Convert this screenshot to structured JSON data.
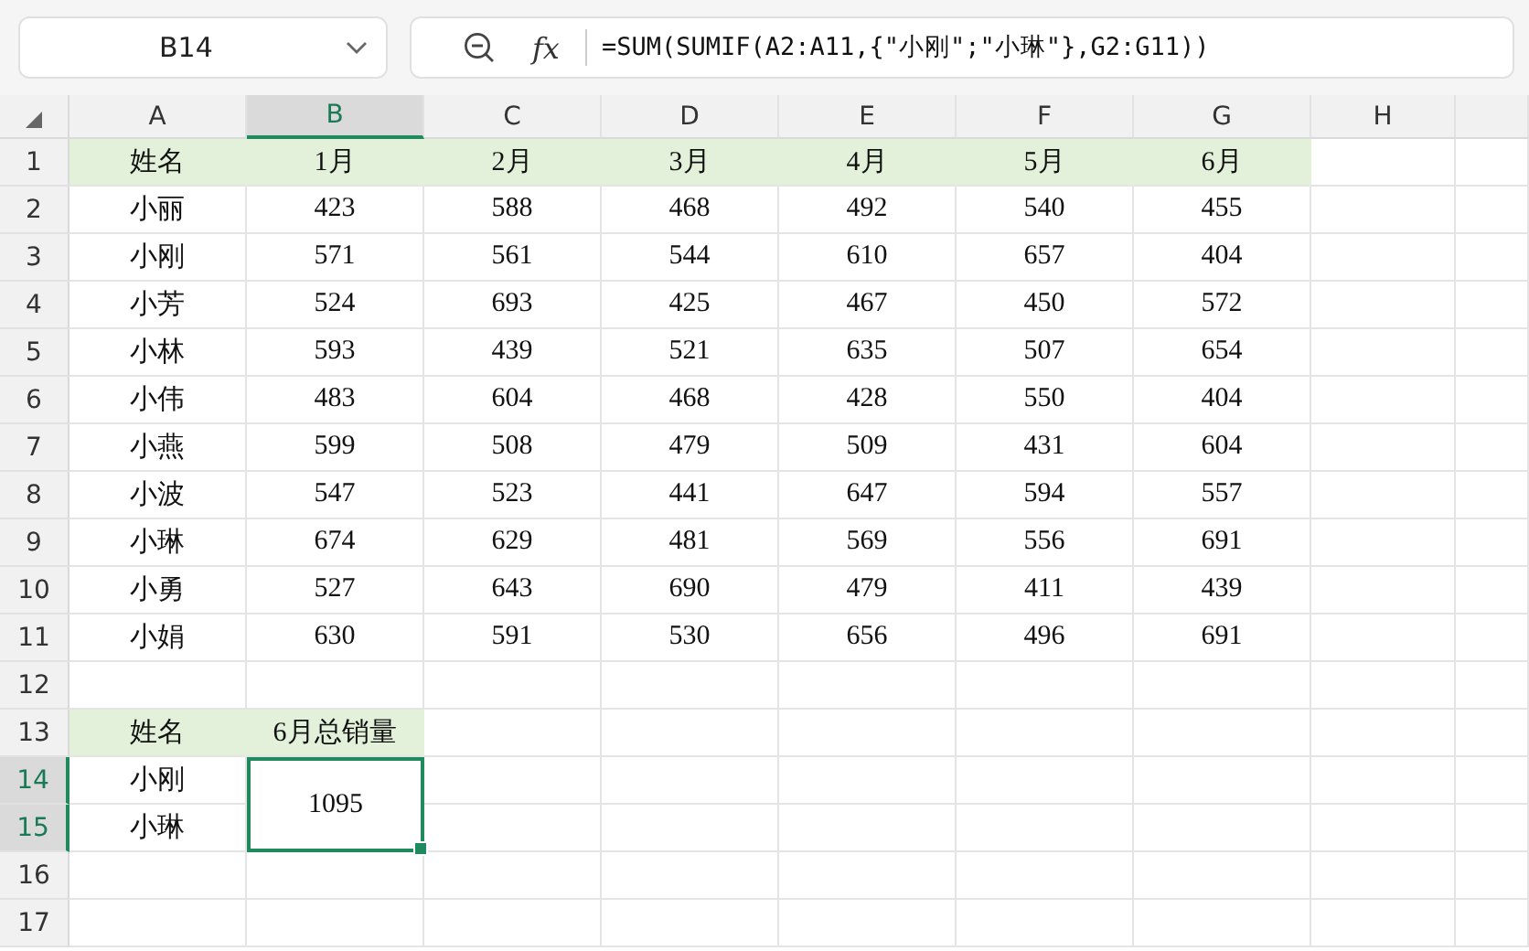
{
  "name_box": {
    "value": "B14"
  },
  "formula_bar": {
    "fx": "fx",
    "formula": "=SUM(SUMIF(A2:A11,{\"小刚\";\"小琳\"},G2:G11))"
  },
  "columns": [
    {
      "label": "A",
      "selected": false
    },
    {
      "label": "B",
      "selected": true
    },
    {
      "label": "C",
      "selected": false
    },
    {
      "label": "D",
      "selected": false
    },
    {
      "label": "E",
      "selected": false
    },
    {
      "label": "F",
      "selected": false
    },
    {
      "label": "G",
      "selected": false
    },
    {
      "label": "H",
      "selected": false
    }
  ],
  "rows": [
    {
      "number": "1",
      "selected": false,
      "kind": "header",
      "cells": [
        "姓名",
        "1月",
        "2月",
        "3月",
        "4月",
        "5月",
        "6月"
      ]
    },
    {
      "number": "2",
      "selected": false,
      "kind": "data",
      "cells": [
        "小丽",
        "423",
        "588",
        "468",
        "492",
        "540",
        "455"
      ]
    },
    {
      "number": "3",
      "selected": false,
      "kind": "data",
      "cells": [
        "小刚",
        "571",
        "561",
        "544",
        "610",
        "657",
        "404"
      ]
    },
    {
      "number": "4",
      "selected": false,
      "kind": "data",
      "cells": [
        "小芳",
        "524",
        "693",
        "425",
        "467",
        "450",
        "572"
      ]
    },
    {
      "number": "5",
      "selected": false,
      "kind": "data",
      "cells": [
        "小林",
        "593",
        "439",
        "521",
        "635",
        "507",
        "654"
      ]
    },
    {
      "number": "6",
      "selected": false,
      "kind": "data",
      "cells": [
        "小伟",
        "483",
        "604",
        "468",
        "428",
        "550",
        "404"
      ]
    },
    {
      "number": "7",
      "selected": false,
      "kind": "data",
      "cells": [
        "小燕",
        "599",
        "508",
        "479",
        "509",
        "431",
        "604"
      ]
    },
    {
      "number": "8",
      "selected": false,
      "kind": "data",
      "cells": [
        "小波",
        "547",
        "523",
        "441",
        "647",
        "594",
        "557"
      ]
    },
    {
      "number": "9",
      "selected": false,
      "kind": "data",
      "cells": [
        "小琳",
        "674",
        "629",
        "481",
        "569",
        "556",
        "691"
      ]
    },
    {
      "number": "10",
      "selected": false,
      "kind": "data",
      "cells": [
        "小勇",
        "527",
        "643",
        "690",
        "479",
        "411",
        "439"
      ]
    },
    {
      "number": "11",
      "selected": false,
      "kind": "data",
      "cells": [
        "小娟",
        "630",
        "591",
        "530",
        "656",
        "496",
        "691"
      ]
    },
    {
      "number": "12",
      "selected": false,
      "cells": []
    },
    {
      "number": "13",
      "selected": false,
      "kind": "header",
      "cells": [
        "姓名",
        "6月总销量"
      ]
    },
    {
      "number": "14",
      "selected": true,
      "kind": "data",
      "cells": [
        "小刚"
      ]
    },
    {
      "number": "15",
      "selected": true,
      "kind": "data",
      "cells": [
        "小琳"
      ]
    },
    {
      "number": "16",
      "selected": false,
      "cells": []
    },
    {
      "number": "17",
      "selected": false,
      "cells": []
    }
  ],
  "merged_cell": {
    "value": "1095",
    "selected": true
  }
}
